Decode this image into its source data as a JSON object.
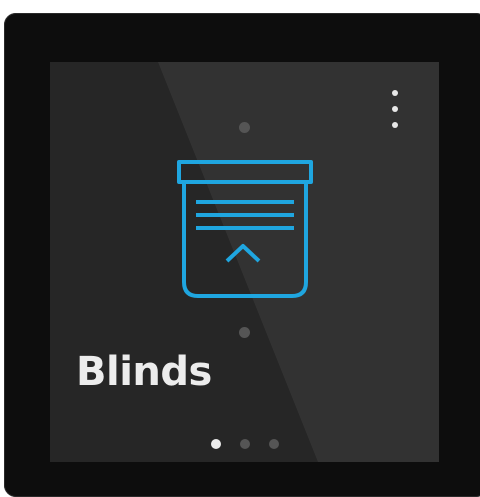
{
  "device": {
    "screen_color": "#262626",
    "bezel_color": "#0d0d0d"
  },
  "header": {
    "menu_icon": "vertical-ellipsis-icon"
  },
  "main": {
    "title": "Blinds",
    "control_icon": "blinds-up-icon",
    "accent_color": "#1fa6e0"
  },
  "pager": {
    "count": 3,
    "active_index": 0,
    "active_color": "#ececec",
    "inactive_color": "#555555"
  }
}
